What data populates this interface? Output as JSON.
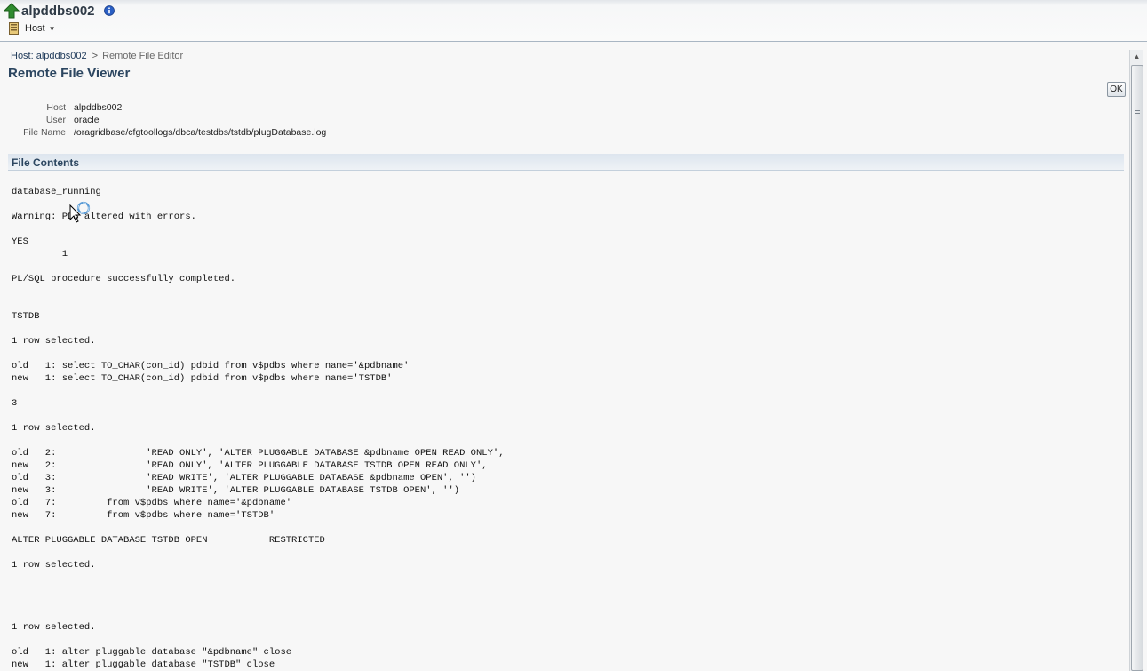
{
  "header": {
    "target_name": "alpddbs002",
    "icons": [
      "up-arrow-icon",
      "info-icon",
      "host-icon",
      "chevron-down-icon"
    ],
    "menu": {
      "host_label": "Host"
    }
  },
  "breadcrumb": {
    "host_link": "Host: alpddbs002",
    "separator": ">",
    "current": "Remote File Editor"
  },
  "page": {
    "title": "Remote File Viewer",
    "ok_label": "OK"
  },
  "properties": [
    {
      "label": "Host",
      "value": "alpddbs002"
    },
    {
      "label": "User",
      "value": "oracle"
    },
    {
      "label": "File Name",
      "value": "/oragridbase/cfgtoollogs/dbca/testdbs/tstdb/plugDatabase.log"
    }
  ],
  "section": {
    "title": "File Contents"
  },
  "file_contents": "database_running\n\nWarning: PDB altered with errors.\n\nYES\n         1\n\nPL/SQL procedure successfully completed.\n\n\nTSTDB\n\n1 row selected.\n\nold   1: select TO_CHAR(con_id) pdbid from v$pdbs where name='&pdbname'\nnew   1: select TO_CHAR(con_id) pdbid from v$pdbs where name='TSTDB'\n\n3\n\n1 row selected.\n\nold   2:                'READ ONLY', 'ALTER PLUGGABLE DATABASE &pdbname OPEN READ ONLY',\nnew   2:                'READ ONLY', 'ALTER PLUGGABLE DATABASE TSTDB OPEN READ ONLY',\nold   3:                'READ WRITE', 'ALTER PLUGGABLE DATABASE &pdbname OPEN', '')\nnew   3:                'READ WRITE', 'ALTER PLUGGABLE DATABASE TSTDB OPEN', '')\nold   7:         from v$pdbs where name='&pdbname'\nnew   7:         from v$pdbs where name='TSTDB'\n\nALTER PLUGGABLE DATABASE TSTDB OPEN           RESTRICTED\n\n1 row selected.\n\n\n\n\n1 row selected.\n\nold   1: alter pluggable database \"&pdbname\" close\nnew   1: alter pluggable database \"TSTDB\" close",
  "colors": {
    "title": "#2c4660",
    "link": "#1f3a5a",
    "banner_border": "#a9b6c3",
    "up_arrow": "#2e8b2e",
    "info": "#2a5fc4"
  }
}
